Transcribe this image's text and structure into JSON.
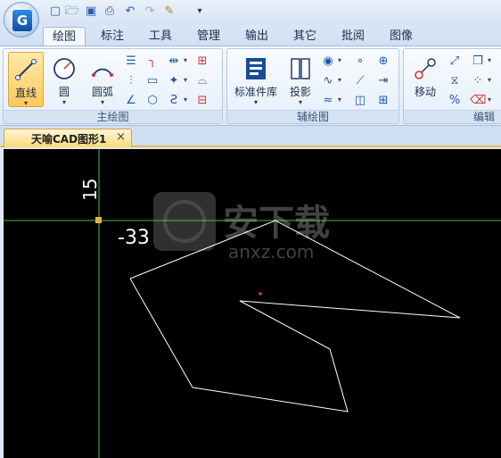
{
  "menu_tabs": [
    "绘图",
    "标注",
    "工具",
    "管理",
    "输出",
    "其它",
    "批阅",
    "图像"
  ],
  "active_tab": "绘图",
  "ribbon": {
    "draw_group": {
      "label": "主绘图",
      "line_label": "直线",
      "circle_label": "圆",
      "arc_label": "圆弧"
    },
    "aux_group": {
      "label": "辅绘图",
      "standard_parts_label": "标准件库",
      "projection_label": "投影"
    },
    "edit_group": {
      "label": "编辑",
      "move_label": "移动"
    }
  },
  "document": {
    "tab_title": "天喻CAD图形1",
    "close_glyph": "×"
  },
  "canvas": {
    "dimension_vertical": "15",
    "dimension_horizontal": "-33",
    "watermark_main": "安下载",
    "watermark_sub": "anxz.com",
    "colors": {
      "background": "#000000",
      "crosshair": "#3fbf3f",
      "geometry": "#ffffff",
      "grip": "#e8b040",
      "dimension_text": "#ffffff"
    }
  },
  "icons": {
    "app_logo": "app-logo-icon",
    "quick_access": [
      "new-file-icon",
      "open-folder-icon",
      "save-icon",
      "print-preview-icon",
      "undo-icon",
      "redo-icon",
      "clear-brush-icon",
      "customize-dropdown-icon"
    ]
  }
}
